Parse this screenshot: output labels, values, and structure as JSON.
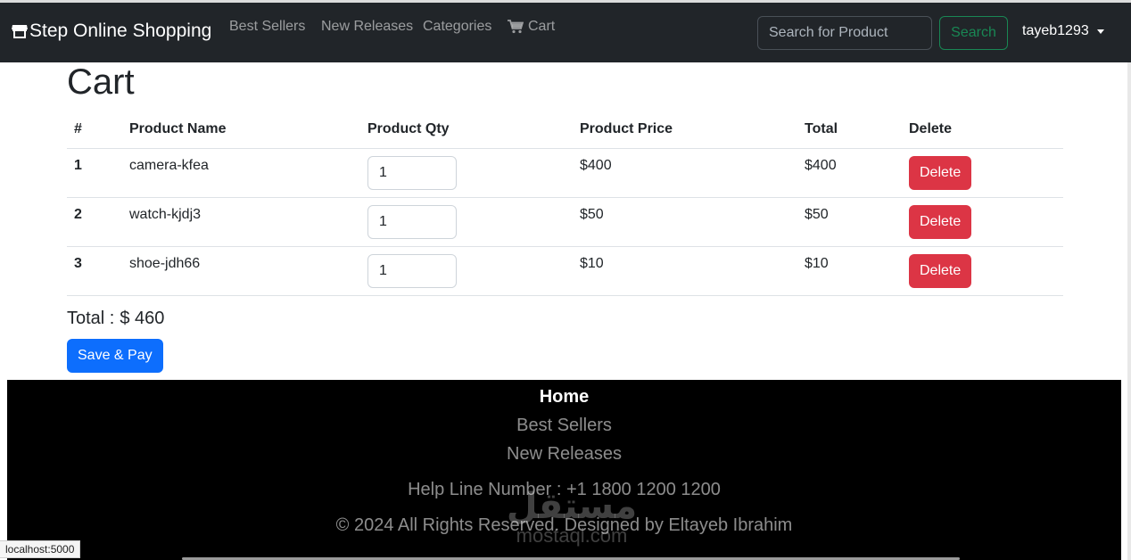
{
  "navbar": {
    "brand": "Step Online Shopping",
    "links": [
      "Best Sellers",
      "New Releases",
      "Categories"
    ],
    "cart_label": "Cart",
    "search_placeholder": "Search for Product",
    "search_button": "Search",
    "username": "tayeb1293"
  },
  "page": {
    "title": "Cart"
  },
  "cart": {
    "columns": [
      "#",
      "Product Name",
      "Product Qty",
      "Product Price",
      "Total",
      "Delete"
    ],
    "rows": [
      {
        "index": "1",
        "name": "camera-kfea",
        "qty": "1",
        "price": "$400",
        "total": "$400",
        "delete_label": "Delete"
      },
      {
        "index": "2",
        "name": "watch-kjdj3",
        "qty": "1",
        "price": "$50",
        "total": "$50",
        "delete_label": "Delete"
      },
      {
        "index": "3",
        "name": "shoe-jdh66",
        "qty": "1",
        "price": "$10",
        "total": "$10",
        "delete_label": "Delete"
      }
    ],
    "total_label": "Total :",
    "total_value": "$ 460",
    "pay_button": "Save & Pay"
  },
  "footer": {
    "home": "Home",
    "best_sellers": "Best Sellers",
    "new_releases": "New Releases",
    "help_line": "Help Line Number : +1 1800 1200 1200",
    "copyright": "© 2024 All Rights Reserved. Designed by Eltayeb Ibrahim",
    "watermark_arabic": "مستقل",
    "watermark_latin": "mostaql.com"
  },
  "status_bar": {
    "url": "localhost:5000"
  },
  "colors": {
    "navbar_bg": "#212529",
    "search_button": "#198754",
    "delete_button": "#dc3545",
    "pay_button": "#0d6efd",
    "footer_bg": "#000000"
  },
  "icons": {
    "brand": "shop-icon",
    "cart": "cart-icon",
    "user_menu": "caret-down-icon"
  }
}
